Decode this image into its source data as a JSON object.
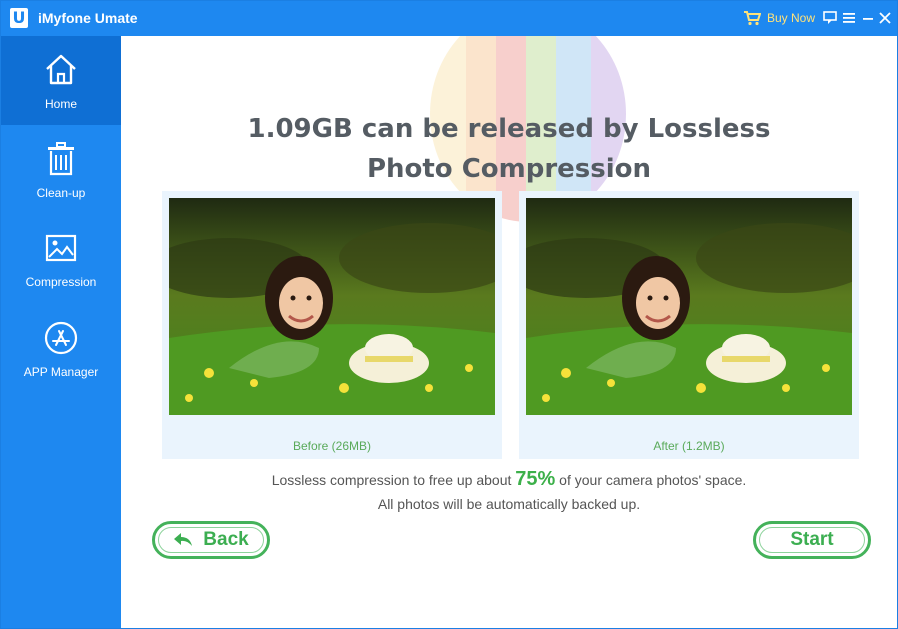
{
  "titlebar": {
    "logo_letter": "U",
    "app_title": "iMyfone Umate",
    "buy_now_label": "Buy Now"
  },
  "sidebar": {
    "items": [
      {
        "label": "Home",
        "icon": "home-icon",
        "active": true
      },
      {
        "label": "Clean-up",
        "icon": "trash-icon",
        "active": false
      },
      {
        "label": "Compression",
        "icon": "image-icon",
        "active": false
      },
      {
        "label": "APP Manager",
        "icon": "app-store-icon",
        "active": false
      }
    ]
  },
  "main": {
    "headline_line1": "1.09GB can be released by Lossless",
    "headline_line2": "Photo Compression",
    "before_caption": "Before (26MB)",
    "after_caption": "After (1.2MB)",
    "info_prefix": "Lossless compression to free up about ",
    "info_percent": "75%",
    "info_suffix": " of your camera photos' space.",
    "info_line2": "All photos will be automatically backed up.",
    "back_label": "Back",
    "start_label": "Start"
  },
  "colors": {
    "sidebar_blue": "#1e88f0",
    "sidebar_active": "#0f6fd4",
    "accent_green": "#3cb04a",
    "buy_now_yellow": "#ffe27a"
  }
}
